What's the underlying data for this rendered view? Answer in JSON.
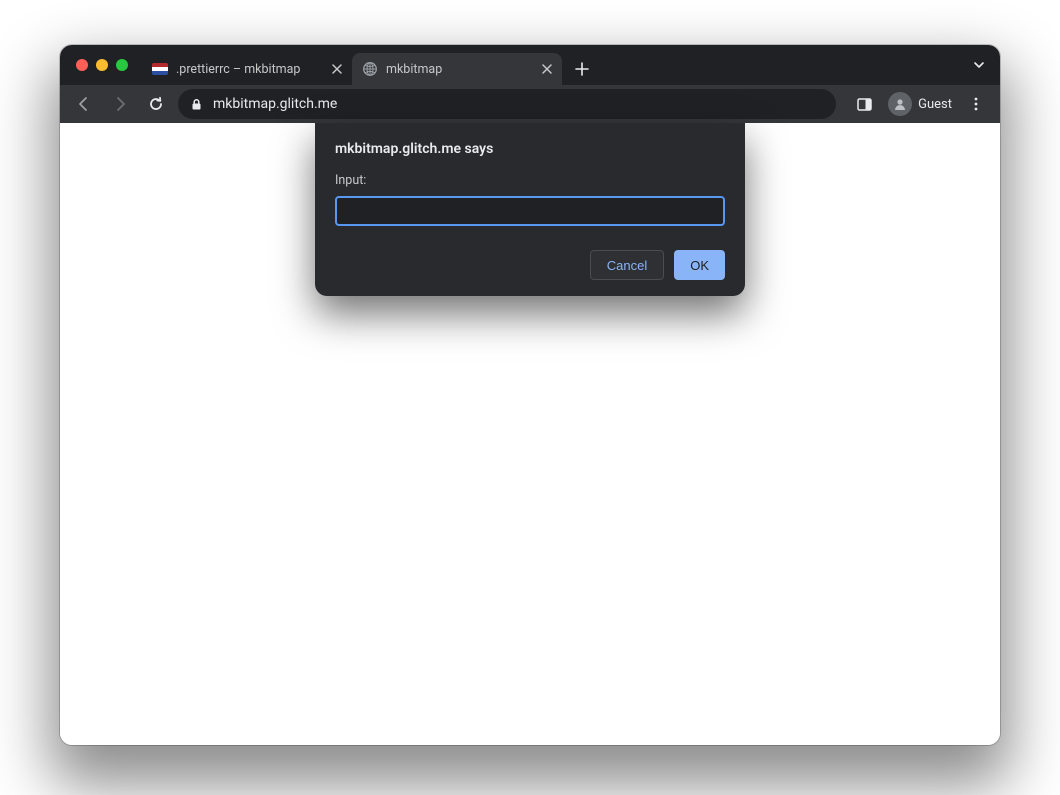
{
  "tabs": [
    {
      "title": ".prettierrc – mkbitmap",
      "active": false,
      "favicon": "flag"
    },
    {
      "title": "mkbitmap",
      "active": true,
      "favicon": "globe"
    }
  ],
  "toolbar": {
    "url": "mkbitmap.glitch.me",
    "guest_label": "Guest"
  },
  "prompt": {
    "origin_says": "mkbitmap.glitch.me says",
    "label": "Input:",
    "value": "",
    "cancel": "Cancel",
    "ok": "OK"
  }
}
